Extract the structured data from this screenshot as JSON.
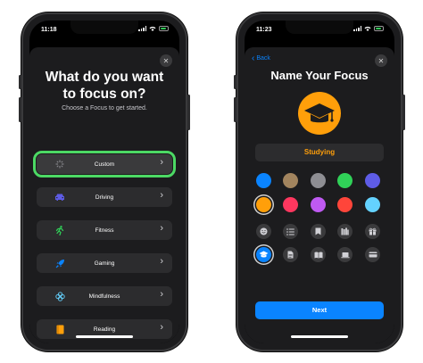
{
  "left_phone": {
    "status": {
      "time": "11:18"
    },
    "heading_line1": "What do you want",
    "heading_line2": "to focus on?",
    "subtitle": "Choose a Focus to get started.",
    "close_glyph": "✕",
    "rows": [
      {
        "label": "Custom",
        "icon": "sparkle-icon",
        "icon_color": "#8e8e93",
        "selected": true
      },
      {
        "label": "Driving",
        "icon": "car-icon",
        "icon_color": "#5e5ce6",
        "selected": false
      },
      {
        "label": "Fitness",
        "icon": "running-icon",
        "icon_color": "#30d158",
        "selected": false
      },
      {
        "label": "Gaming",
        "icon": "rocket-icon",
        "icon_color": "#0a84ff",
        "selected": false
      },
      {
        "label": "Mindfulness",
        "icon": "flower-icon",
        "icon_color": "#64d2ff",
        "selected": false
      },
      {
        "label": "Reading",
        "icon": "book-icon",
        "icon_color": "#ff9f0a",
        "selected": false
      }
    ],
    "chevron": "›"
  },
  "right_phone": {
    "status": {
      "time": "11:23"
    },
    "back_label": "Back",
    "back_glyph": "‹",
    "close_glyph": "✕",
    "heading": "Name Your Focus",
    "name_value": "Studying",
    "colors": [
      "#0a84ff",
      "#a2845e",
      "#8e8e93",
      "#30d158",
      "#5e5ce6",
      "#ff9f0a",
      "#ff375f",
      "#bf5af2",
      "#ff453a",
      "#64d2ff"
    ],
    "selected_color_index": 5,
    "glyphs_row1": [
      "smiley-icon",
      "list-icon",
      "bookmark-icon",
      "books-icon",
      "gift-icon"
    ],
    "glyphs_row2": [
      "graduation-cap-icon",
      "document-icon",
      "open-book-icon",
      "laptop-icon",
      "card-icon"
    ],
    "selected_glyph": "graduation-cap-icon",
    "next_label": "Next"
  },
  "accent": {
    "selection_outline": "#4cd964",
    "link_blue": "#0a84ff",
    "studying_orange": "#ff9f0a"
  }
}
